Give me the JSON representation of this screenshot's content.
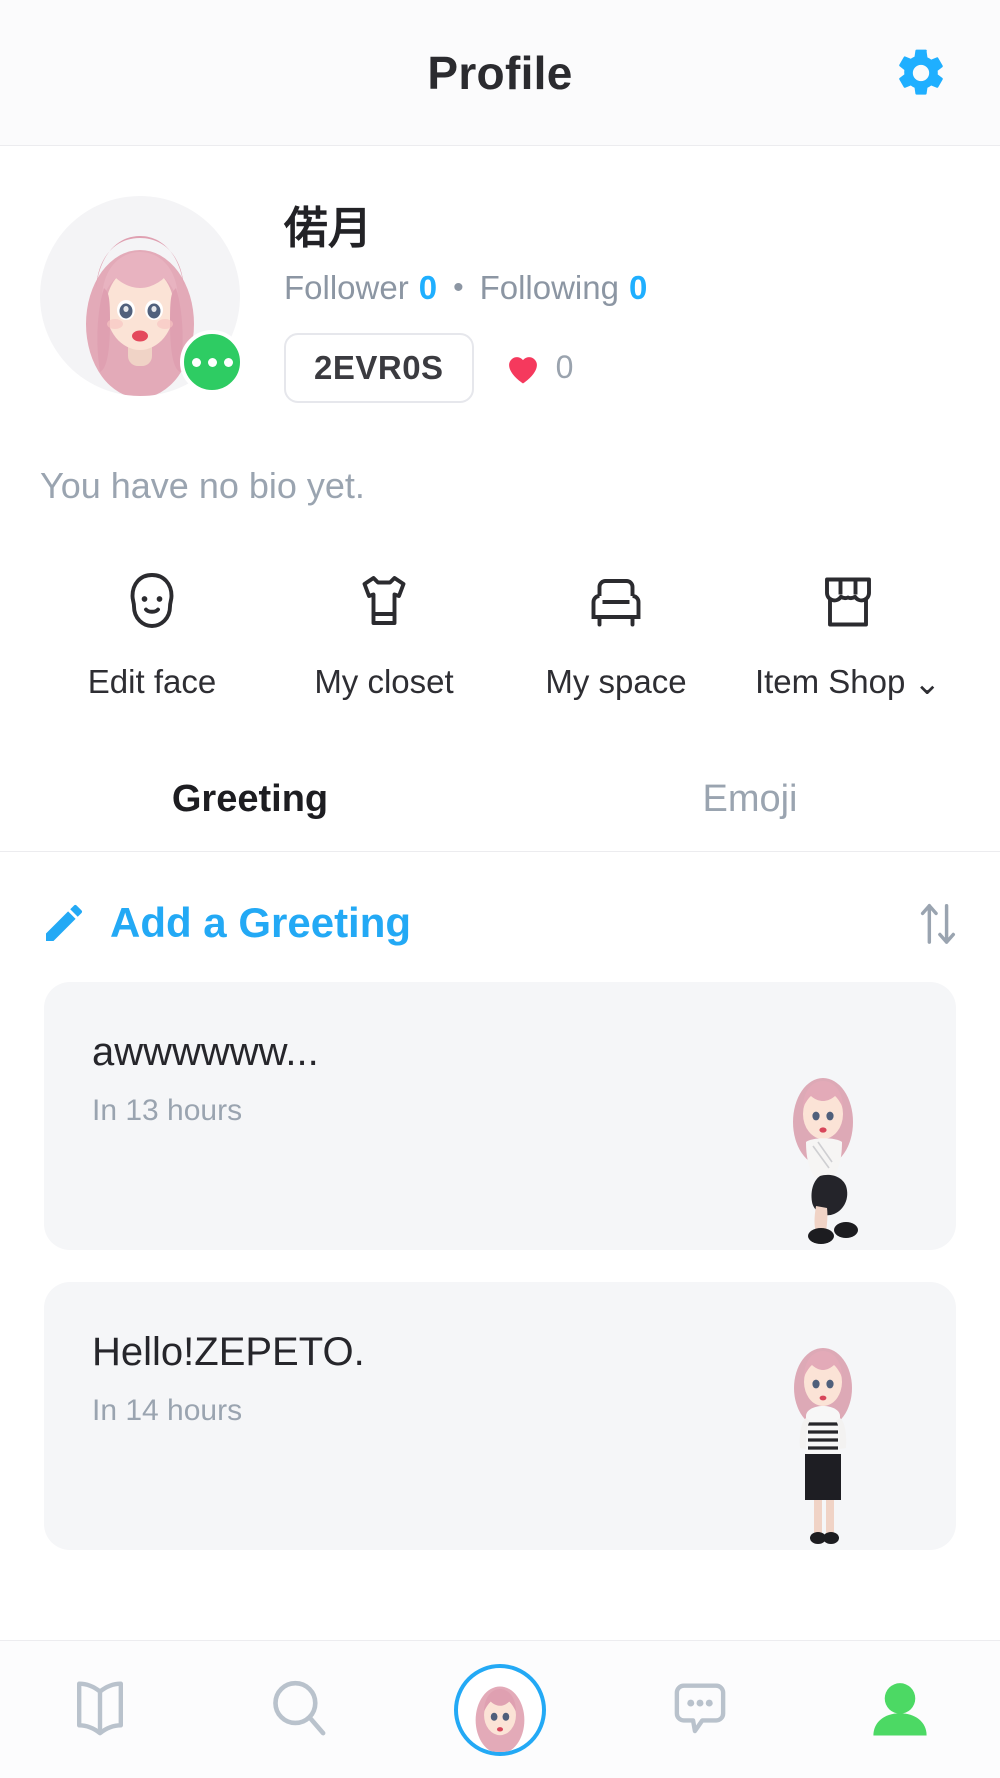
{
  "header": {
    "title": "Profile",
    "settings_icon": "gear-icon"
  },
  "profile": {
    "nickname": "偌月",
    "follower_label": "Follower",
    "follower_count": "0",
    "separator": "•",
    "following_label": "Following",
    "following_count": "0",
    "user_id": "2EVR0S",
    "heart_icon": "heart-icon",
    "heart_count": "0",
    "bio_placeholder": "You have no bio yet.",
    "avatar_more_icon": "more-dots-icon"
  },
  "actions": [
    {
      "label": "Edit face",
      "icon": "face-icon",
      "chevron": ""
    },
    {
      "label": "My closet",
      "icon": "tshirt-icon",
      "chevron": ""
    },
    {
      "label": "My space",
      "icon": "armchair-icon",
      "chevron": ""
    },
    {
      "label": "Item Shop",
      "icon": "shop-icon",
      "chevron": "⌄"
    }
  ],
  "tabs": [
    {
      "label": "Greeting",
      "active": true
    },
    {
      "label": "Emoji",
      "active": false
    }
  ],
  "greeting_section": {
    "add_label": "Add a Greeting",
    "pencil_icon": "pencil-icon",
    "sort_icon": "sort-arrows-icon"
  },
  "greetings": [
    {
      "text": "awwwwww...",
      "time": "In 13 hours",
      "avatar": "avatar-crouching"
    },
    {
      "text": "Hello!ZEPETO.",
      "time": "In 14 hours",
      "avatar": "avatar-standing"
    }
  ],
  "bottom_nav": [
    {
      "name": "feed",
      "icon": "book-icon",
      "active": false
    },
    {
      "name": "search",
      "icon": "search-icon",
      "active": false
    },
    {
      "name": "avatar",
      "icon": "avatar-icon",
      "active": true
    },
    {
      "name": "chat",
      "icon": "chat-bubble-icon",
      "active": false
    },
    {
      "name": "profile",
      "icon": "person-icon",
      "active": true
    }
  ],
  "colors": {
    "accent_blue": "#23a9f5",
    "gear_blue": "#1fafff",
    "heart_red": "#f5395d",
    "badge_green": "#2ecc63",
    "nav_green": "#4cd964",
    "muted_gray": "#9aa4b0",
    "card_bg": "#f5f6f8"
  }
}
